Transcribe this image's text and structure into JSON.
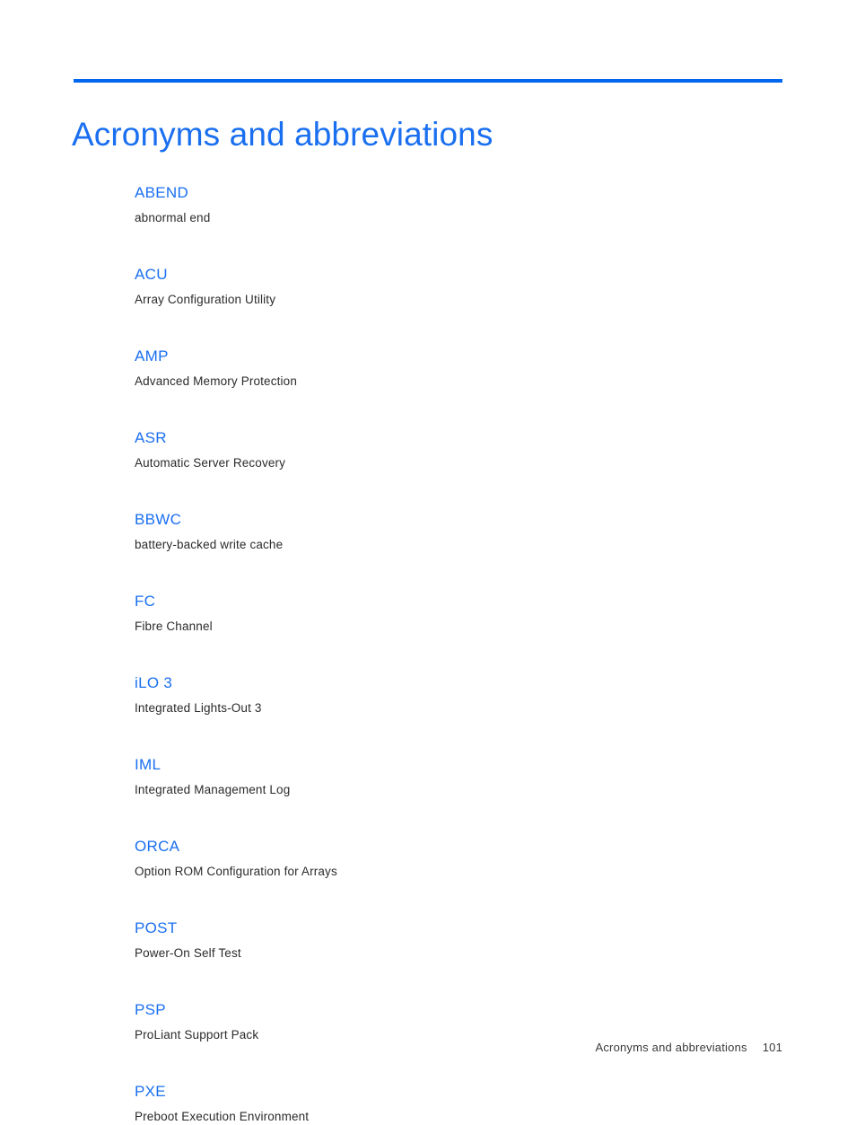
{
  "document": {
    "title": "Acronyms and abbreviations",
    "accent_color": "#1a6ff0",
    "rule_color": "#0066f0",
    "body_text_color": "#2b2b2b",
    "background_color": "#ffffff"
  },
  "glossary": {
    "entries": [
      {
        "term": "ABEND",
        "definition": "abnormal end"
      },
      {
        "term": "ACU",
        "definition": "Array Configuration Utility"
      },
      {
        "term": "AMP",
        "definition": "Advanced Memory Protection"
      },
      {
        "term": "ASR",
        "definition": "Automatic Server Recovery"
      },
      {
        "term": "BBWC",
        "definition": "battery-backed write cache"
      },
      {
        "term": "FC",
        "definition": "Fibre Channel"
      },
      {
        "term": "iLO 3",
        "definition": "Integrated Lights-Out 3"
      },
      {
        "term": "IML",
        "definition": "Integrated Management Log"
      },
      {
        "term": "ORCA",
        "definition": "Option ROM Configuration for Arrays"
      },
      {
        "term": "POST",
        "definition": "Power-On Self Test"
      },
      {
        "term": "PSP",
        "definition": "ProLiant Support Pack"
      },
      {
        "term": "PXE",
        "definition": "Preboot Execution Environment"
      }
    ]
  },
  "footer": {
    "chapter": "Acronyms and abbreviations",
    "page_number": "101"
  }
}
